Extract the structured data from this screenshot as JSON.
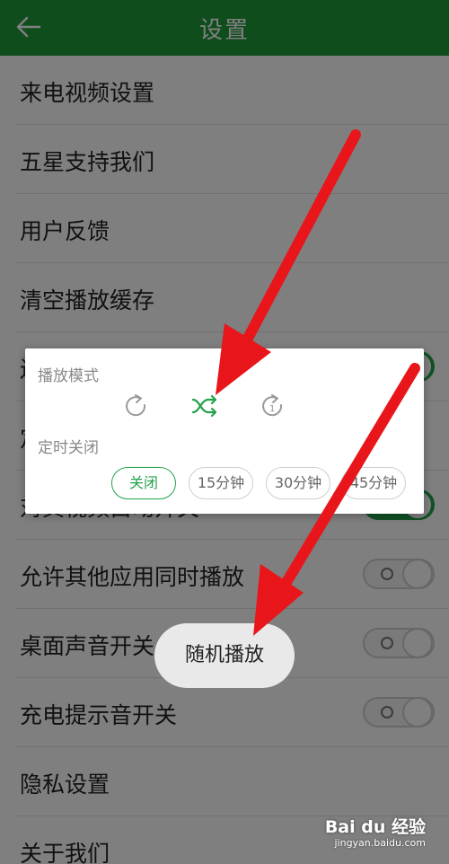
{
  "header": {
    "title": "设置",
    "back_icon": "arrow-left-icon"
  },
  "settings": [
    {
      "label": "来电视频设置"
    },
    {
      "label": "五星支持我们"
    },
    {
      "label": "用户反馈"
    },
    {
      "label": "清空播放缓存"
    },
    {
      "label": "边",
      "toggle": "on"
    },
    {
      "label": "定"
    },
    {
      "label": "对其视频白动开关",
      "toggle": "on"
    },
    {
      "label": "允许其他应用同时播放",
      "toggle": "off"
    },
    {
      "label": "桌面声音开关",
      "toggle": "off"
    },
    {
      "label": "充电提示音开关",
      "toggle": "off"
    },
    {
      "label": "隐私设置"
    },
    {
      "label": "关于我们"
    }
  ],
  "dialog": {
    "play_mode_label": "播放模式",
    "modes": [
      {
        "icon": "repeat-icon",
        "selected": false
      },
      {
        "icon": "shuffle-icon",
        "selected": true
      },
      {
        "icon": "repeat-one-icon",
        "selected": false,
        "badge": "1"
      }
    ],
    "timer_label": "定时关闭",
    "timer_options": [
      {
        "label": "关闭",
        "selected": true
      },
      {
        "label": "15分钟",
        "selected": false
      },
      {
        "label": "30分钟",
        "selected": false
      },
      {
        "label": "45分钟",
        "selected": false
      }
    ]
  },
  "toast": {
    "text": "随机播放"
  },
  "watermark": {
    "brand": "Bai du 经验",
    "url": "jingyan.baidu.com"
  },
  "colors": {
    "primary": "#1f9a3b",
    "accent": "#22a34a",
    "arrow": "#e8161b"
  }
}
